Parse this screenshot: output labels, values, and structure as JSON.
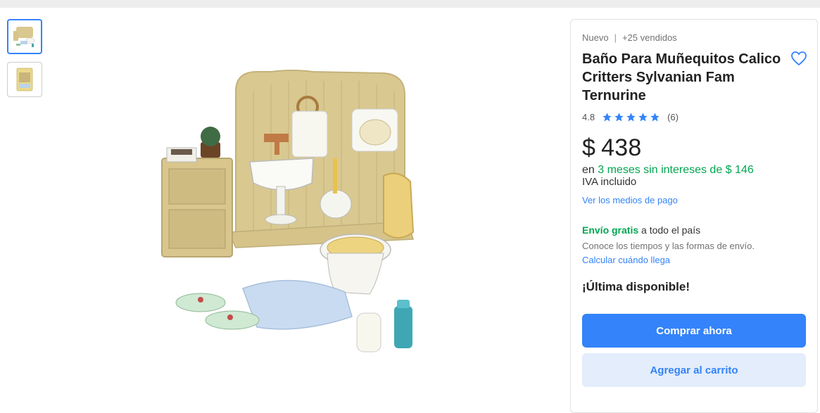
{
  "product": {
    "condition": "Nuevo",
    "separator": "|",
    "sold": "+25 vendidos",
    "title": "Baño Para Muñequitos Calico Critters Sylvanian Fam Ternurine",
    "rating": {
      "value": "4.8",
      "stars": 5,
      "count": "(6)"
    },
    "price": {
      "symbol": "$",
      "amount": "438"
    },
    "installments": {
      "prefix": "en",
      "text": "3 meses sin intereses de $ 146"
    },
    "iva": "IVA incluido",
    "payment_link": "Ver los medios de pago",
    "shipping": {
      "free": "Envío gratis",
      "rest": "a todo el país",
      "subtitle": "Conoce los tiempos y las formas de envío.",
      "link": "Calcular cuándo llega"
    },
    "stock": "¡Última disponible!",
    "buttons": {
      "buy": "Comprar ahora",
      "cart": "Agregar al carrito"
    }
  },
  "gallery": {
    "thumbnails": [
      {
        "name": "thumb-bathroom-set",
        "selected": true
      },
      {
        "name": "thumb-box-packaging",
        "selected": false
      }
    ]
  },
  "colors": {
    "accent": "#3483fa",
    "green": "#00a650",
    "light_button": "#e3edfb"
  },
  "icons": [
    "heart-icon",
    "star-icon"
  ]
}
